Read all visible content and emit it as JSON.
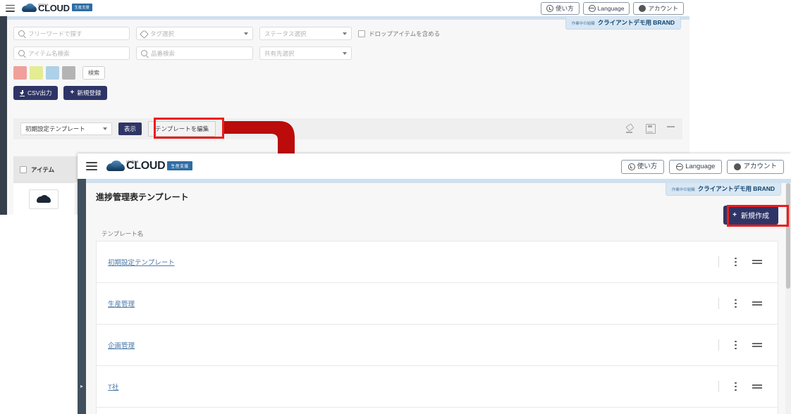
{
  "brand": {
    "sub": "stclera",
    "main": "CLOUD",
    "badge": "生産支援"
  },
  "header": {
    "buttons": [
      {
        "icon": "question-circle-icon",
        "label": "使い方"
      },
      {
        "icon": "globe-icon",
        "label": "Language"
      },
      {
        "icon": "account-icon",
        "label": "アカウント"
      }
    ],
    "org_badge": {
      "label": "作業中の組織",
      "value": "クライアントデモ用 BRAND"
    }
  },
  "window1": {
    "filters": {
      "freeword_placeholder": "フリーワードで探す",
      "tag_placeholder": "タグ選択",
      "status_placeholder": "ステータス選択",
      "include_drop_items_label": "ドロップアイテムを含める",
      "item_name_placeholder": "アイテム名検索",
      "part_number_placeholder": "品番検索",
      "share_target_placeholder": "共有先選択",
      "search_button": "検索",
      "color_swatches": [
        "#f0a09a",
        "#e4ec94",
        "#aed0e8",
        "#b4b4b4"
      ]
    },
    "actions": {
      "csv_export": "CSV出力",
      "new_register": "新規登録",
      "plus": "+"
    },
    "template_bar": {
      "selected_template": "初期設定テンプレート",
      "display_button": "表示",
      "edit_template_button": "テンプレートを編集",
      "icons": [
        "paint-bucket-icon",
        "save-layout-icon",
        "sort-filter-icon"
      ]
    },
    "list": {
      "column_header": "アイテム"
    }
  },
  "window2": {
    "page_title": "進捗管理表テンプレート",
    "create_button": {
      "plus": "+",
      "label": "新規作成"
    },
    "table": {
      "column_header": "テンプレート名",
      "rows": [
        {
          "name": "初期設定テンプレート"
        },
        {
          "name": "生産管理"
        },
        {
          "name": "企画管理"
        },
        {
          "name": "T社"
        }
      ]
    }
  },
  "annotation": {
    "arrow_color": "#bb0b0b",
    "highlight_color": "#ee1b1b"
  }
}
